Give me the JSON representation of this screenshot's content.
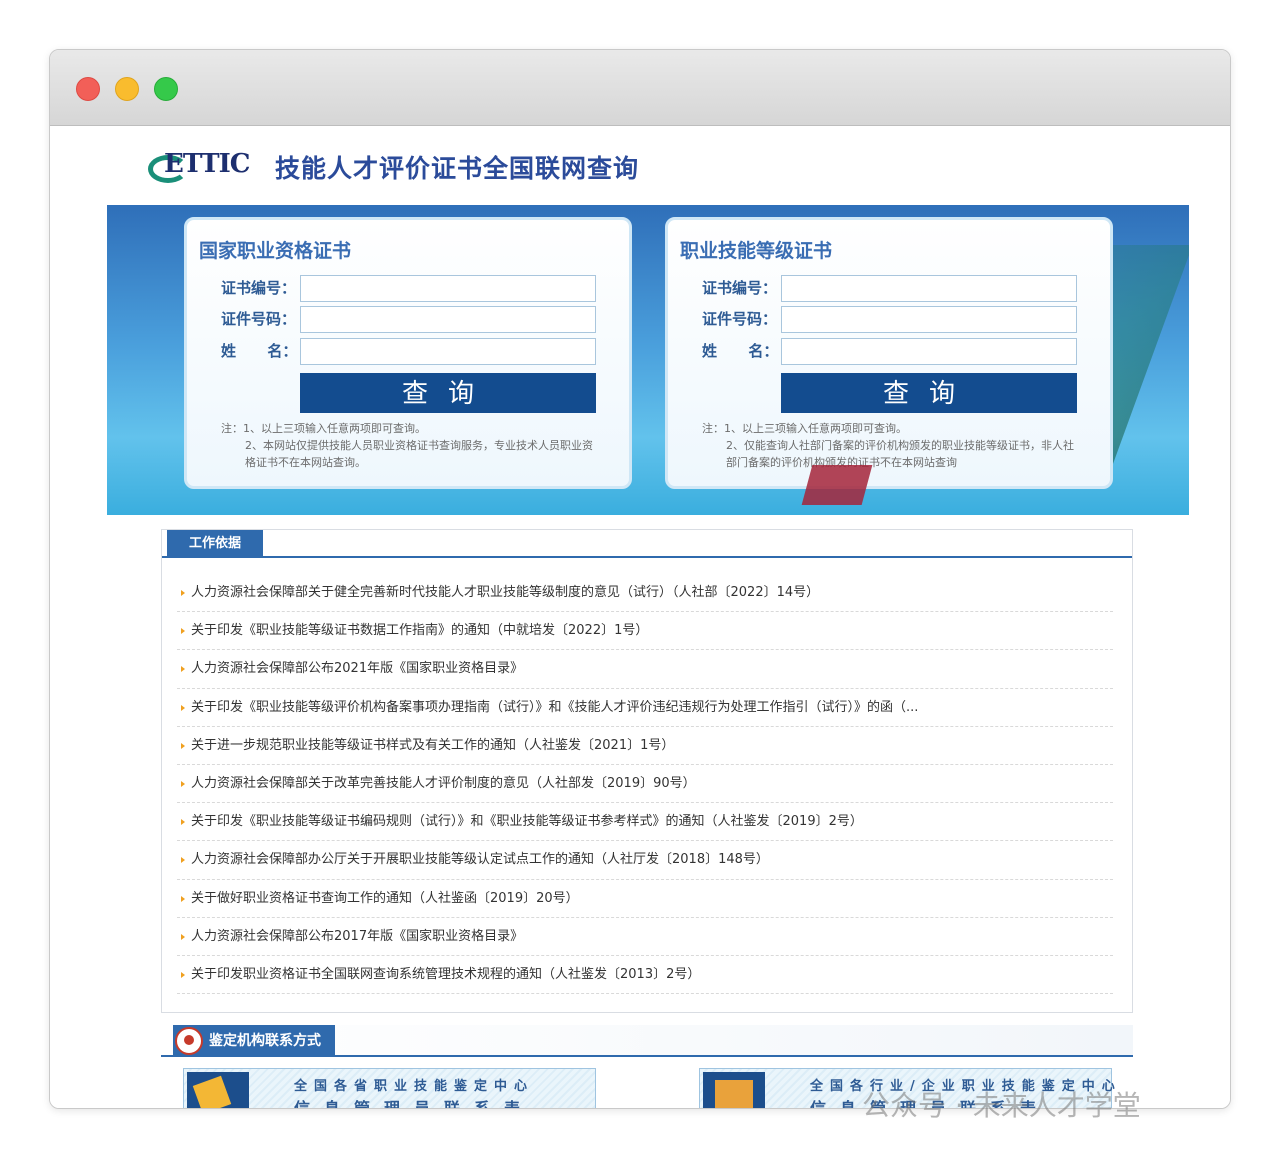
{
  "site": {
    "logo_text": "ETTIC",
    "title": "技能人才评价证书全国联网查询"
  },
  "cards": [
    {
      "title": "国家职业资格证书",
      "field1_label": "证书编号：",
      "field2_label": "证件号码：",
      "field3_label": "姓      名：",
      "button_label": "查询",
      "note_line1": "注：1、以上三项输入任意两项即可查询。",
      "note_line2": "2、本网站仅提供技能人员职业资格证书查询服务，专业技术人员职业资格证书不在本网站查询。"
    },
    {
      "title": "职业技能等级证书",
      "field1_label": "证书编号：",
      "field2_label": "证件号码：",
      "field3_label": "姓      名：",
      "button_label": "查询",
      "note_line1": "注：1、以上三项输入任意两项即可查询。",
      "note_line2": "2、仅能查询人社部门备案的评价机构颁发的职业技能等级证书，非人社部门备案的评价机构颁发的证书不在本网站查询"
    }
  ],
  "work_basis": {
    "tab_label": "工作依据",
    "items": [
      "人力资源社会保障部关于健全完善新时代技能人才职业技能等级制度的意见（试行）（人社部〔2022〕14号）",
      "关于印发《职业技能等级证书数据工作指南》的通知（中就培发〔2022〕1号）",
      "人力资源社会保障部公布2021年版《国家职业资格目录》",
      "关于印发《职业技能等级评价机构备案事项办理指南（试行）》和《技能人才评价违纪违规行为处理工作指引（试行）》的函（...",
      "关于进一步规范职业技能等级证书样式及有关工作的通知（人社鉴发〔2021〕1号）",
      "人力资源社会保障部关于改革完善技能人才评价制度的意见（人社部发〔2019〕90号）",
      "关于印发《职业技能等级证书编码规则（试行）》和《职业技能等级证书参考样式》的通知（人社鉴发〔2019〕2号）",
      "人力资源社会保障部办公厅关于开展职业技能等级认定试点工作的通知（人社厅发〔2018〕148号）",
      "关于做好职业资格证书查询工作的通知（人社鉴函〔2019〕20号）",
      "人力资源社会保障部公布2017年版《国家职业资格目录》",
      "关于印发职业资格证书全国联网查询系统管理技术规程的通知（人社鉴发〔2013〕2号）"
    ]
  },
  "contact": {
    "tab_label": "鉴定机构联系方式",
    "box_a_line1": "全国各省职业技能鉴定中心",
    "box_a_line2": "信息管理员联系表",
    "box_b_line1": "全国各行业/企业职业技能鉴定中心",
    "box_b_line2": "信息管理员联系表"
  },
  "watermark": "公众号 · 未来人才学堂"
}
